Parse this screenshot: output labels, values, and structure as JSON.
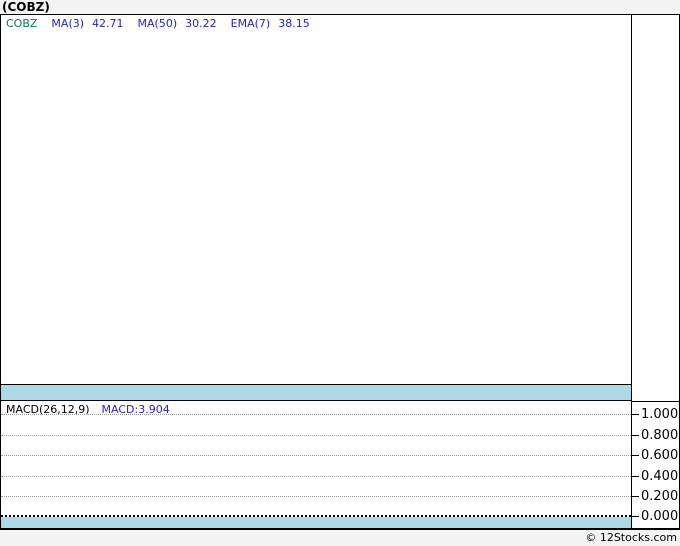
{
  "window": {
    "title": "(COBZ)"
  },
  "price_panel": {
    "symbol": "COBZ",
    "indicators": [
      {
        "label": "MA(3)",
        "value": "42.71"
      },
      {
        "label": "MA(50)",
        "value": "30.22"
      },
      {
        "label": "EMA(7)",
        "value": "38.15"
      }
    ]
  },
  "macd_panel": {
    "label": "MACD(26,12,9)",
    "value": "MACD:3.904",
    "ticks": [
      "1.000",
      "0.800",
      "0.600",
      "0.400",
      "0.200",
      "0.000"
    ]
  },
  "footer": {
    "credit": "© 12Stocks.com"
  },
  "colors": {
    "symbol_green": "#0a7a50",
    "indicator_blue": "#2222cc",
    "band_cyan": "#add8e6",
    "gridline_gray": "#999999",
    "frame_black": "#000000",
    "page_gray": "#f4f4f4"
  },
  "chart_data": [
    {
      "type": "line",
      "title": "(COBZ)",
      "series": [
        {
          "name": "COBZ",
          "values": []
        },
        {
          "name": "MA(3)",
          "values": [],
          "last_value": 42.71
        },
        {
          "name": "MA(50)",
          "values": [],
          "last_value": 30.22
        },
        {
          "name": "EMA(7)",
          "values": [],
          "last_value": 38.15
        }
      ],
      "legend_position": "top-left",
      "grid": false,
      "note": "Price panel area is blank in the screenshot — no candles or indicator lines are plotted."
    },
    {
      "type": "line",
      "title": "MACD(26,12,9)",
      "series": [
        {
          "name": "MACD",
          "values": [],
          "last_value": 3.904
        }
      ],
      "ylim": [
        0.0,
        1.0
      ],
      "yticks": [
        1.0,
        0.8,
        0.6,
        0.4,
        0.2,
        0.0
      ],
      "grid": true,
      "legend_position": "top-left",
      "note": "Only dotted horizontal gridlines visible; zero line rendered as dense black dotted line."
    }
  ]
}
